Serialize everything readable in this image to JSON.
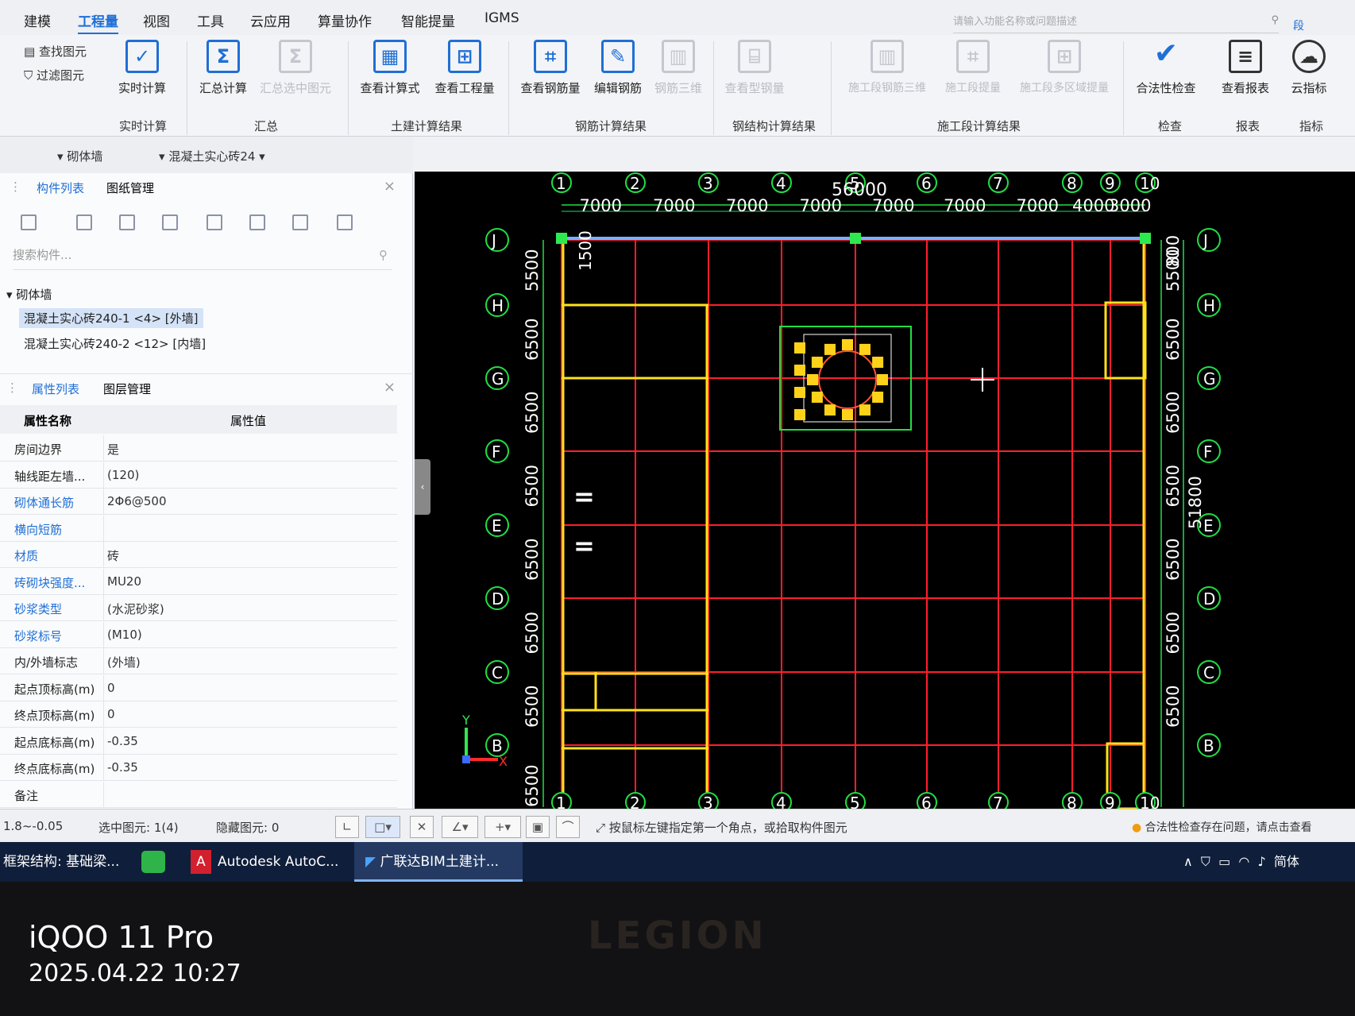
{
  "menubar": {
    "items": [
      "建模",
      "工程量",
      "视图",
      "工具",
      "云应用",
      "算量协作",
      "智能提量",
      "IGMS"
    ],
    "active": "工程量",
    "search_placeholder": "请输入功能名称或问题描述",
    "right_label": "段"
  },
  "ribbon": {
    "find_label": "查找图元",
    "filter_label": "过滤图元",
    "buttons": {
      "realtime": "实时计算",
      "summary": "汇总计算",
      "summary_selected": "汇总选中图元",
      "view_formula": "查看计算式",
      "view_quantity": "查看工程量",
      "view_rebar": "查看钢筋量",
      "edit_rebar": "编辑钢筋",
      "rebar_3d": "钢筋三维",
      "view_steel": "查看型钢量",
      "section_rebar_3d": "施工段钢筋三维",
      "section_extract": "施工段提量",
      "section_multi": "施工段多区域提量",
      "validity_check": "合法性检查",
      "view_report": "查看报表",
      "cloud_index": "云指标"
    },
    "groups": {
      "realtime": "实时计算",
      "summary": "汇总",
      "civil": "土建计算结果",
      "rebar": "钢筋计算结果",
      "steel": "钢结构计算结果",
      "section": "施工段计算结果",
      "check": "检查",
      "report": "报表",
      "index": "指标"
    }
  },
  "selector": {
    "category": "砌体墙",
    "component": "混凝土实心砖24"
  },
  "component_panel": {
    "tabs": [
      "构件列表",
      "图纸管理"
    ],
    "search_placeholder": "搜索构件...",
    "group": "砌体墙",
    "items": [
      "混凝土实心砖240-1 <4> [外墙]",
      "混凝土实心砖240-2 <12> [内墙]"
    ]
  },
  "property_panel": {
    "tabs": [
      "属性列表",
      "图层管理"
    ],
    "header_name": "属性名称",
    "header_value": "属性值",
    "rows": [
      {
        "name": "房间边界",
        "value": "是",
        "blue": false
      },
      {
        "name": "轴线距左墙...",
        "value": "(120)",
        "blue": false
      },
      {
        "name": "砌体通长筋",
        "value": "2Φ6@500",
        "blue": true
      },
      {
        "name": "横向短筋",
        "value": "",
        "blue": true
      },
      {
        "name": "材质",
        "value": "砖",
        "blue": true
      },
      {
        "name": "砖砌块强度...",
        "value": "MU20",
        "blue": true
      },
      {
        "name": "砂浆类型",
        "value": "(水泥砂浆)",
        "blue": true
      },
      {
        "name": "砂浆标号",
        "value": "(M10)",
        "blue": true
      },
      {
        "name": "内/外墙标志",
        "value": "(外墙)",
        "blue": false
      },
      {
        "name": "起点顶标高(m)",
        "value": "0",
        "blue": false
      },
      {
        "name": "终点顶标高(m)",
        "value": "0",
        "blue": false
      },
      {
        "name": "起点底标高(m)",
        "value": "-0.35",
        "blue": false
      },
      {
        "name": "终点底标高(m)",
        "value": "-0.35",
        "blue": false
      },
      {
        "name": "备注",
        "value": "",
        "blue": false
      }
    ]
  },
  "drawing": {
    "col_axes": [
      "1",
      "2",
      "3",
      "4",
      "5",
      "6",
      "7",
      "8",
      "9",
      "10"
    ],
    "row_axes": [
      "J",
      "H",
      "G",
      "F",
      "E",
      "D",
      "C",
      "B"
    ],
    "top_spacings": [
      "7000",
      "7000",
      "7000",
      "7000",
      "7000",
      "7000",
      "7000",
      "4000",
      "3000"
    ],
    "total_width": "56000",
    "left_spacings": [
      "5500",
      "6500",
      "6500",
      "6500",
      "6500",
      "6500",
      "6500"
    ],
    "right_spacings": [
      "5500",
      "6500",
      "6500",
      "6500",
      "6500",
      "6500",
      "6500"
    ],
    "total_height": "51800",
    "top_right_dims": "800",
    "extra_label": "1500",
    "wall_marks": [
      "=",
      "="
    ],
    "bottom_left_dim": "6500",
    "axis_x": "X",
    "axis_y": "Y"
  },
  "statusbar": {
    "elevation": "1.8~-0.05",
    "selected": "选中图元: 1(4)",
    "hidden": "隐藏图元: 0",
    "hint": "按鼠标左键指定第一个角点，或拾取构件图元",
    "warning": "合法性检查存在问题，请点击查看"
  },
  "taskbar": {
    "items": [
      "框架结构: 基础梁...",
      "Autodesk AutoC...",
      "广联达BIM土建计..."
    ],
    "ime": "简体"
  },
  "photo": {
    "brand": "LEGION",
    "watermark_device": "iQOO 11 Pro",
    "watermark_time": "2025.04.22 10:27"
  },
  "colors": {
    "accent": "#1f6fd6",
    "grid": "#ff1e2d",
    "wall": "#ffe21a",
    "axis": "#22dd44"
  }
}
